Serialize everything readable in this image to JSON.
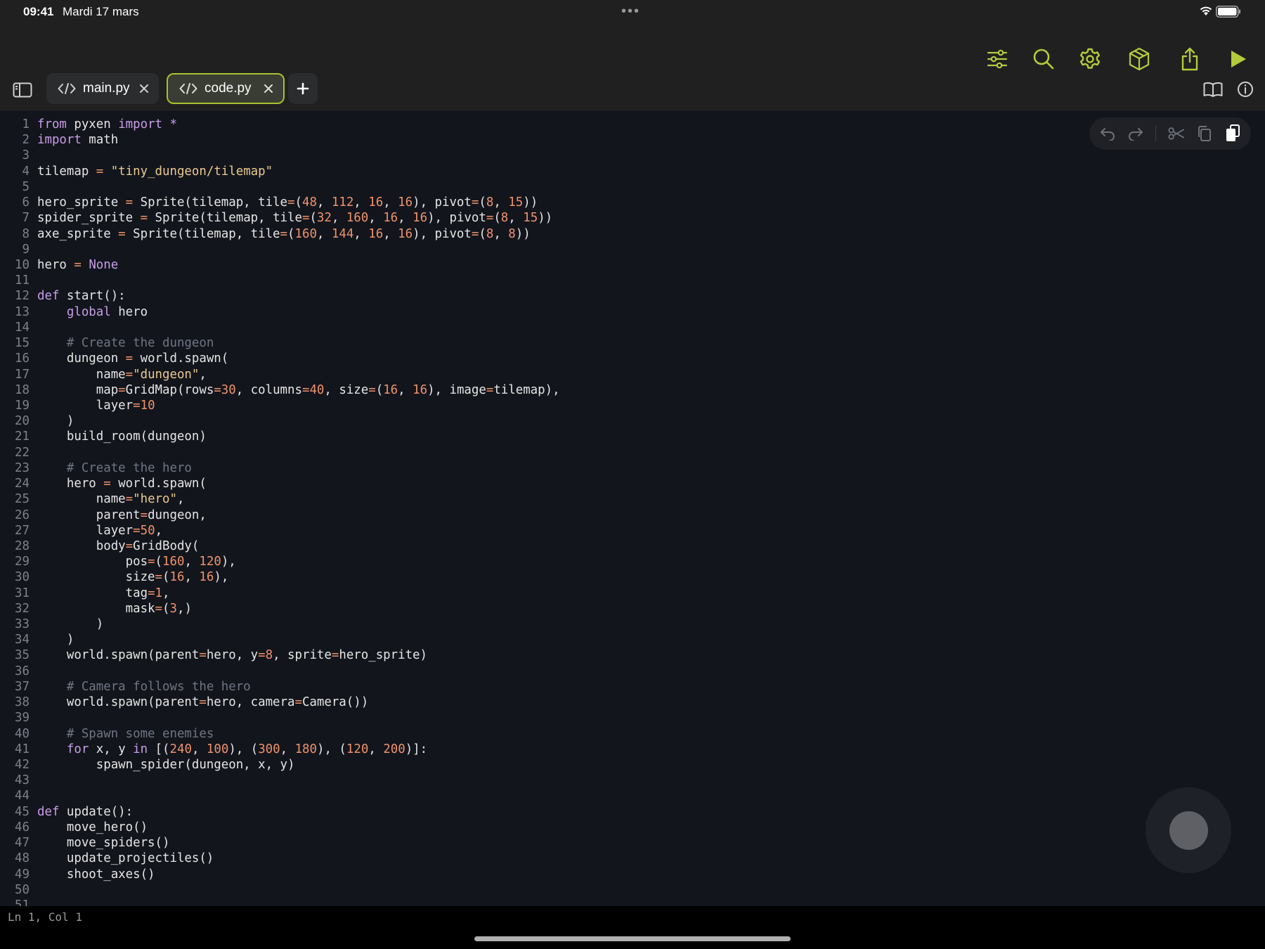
{
  "status": {
    "time": "09:41",
    "date": "Mardi 17 mars"
  },
  "toolbar": {
    "icons": [
      "sliders-icon",
      "search-icon",
      "gear-icon",
      "package-icon",
      "share-icon",
      "play-icon"
    ],
    "accent_color": "#b5cc3a"
  },
  "tabs": [
    {
      "label": "main.py",
      "active": false
    },
    {
      "label": "code.py",
      "active": true
    }
  ],
  "editor": {
    "lines": [
      "from pyxen import *",
      "import math",
      "",
      "tilemap = \"tiny_dungeon/tilemap\"",
      "",
      "hero_sprite = Sprite(tilemap, tile=(48, 112, 16, 16), pivot=(8, 15))",
      "spider_sprite = Sprite(tilemap, tile=(32, 160, 16, 16), pivot=(8, 15))",
      "axe_sprite = Sprite(tilemap, tile=(160, 144, 16, 16), pivot=(8, 8))",
      "",
      "hero = None",
      "",
      "def start():",
      "    global hero",
      "",
      "    # Create the dungeon",
      "    dungeon = world.spawn(",
      "        name=\"dungeon\",",
      "        map=GridMap(rows=30, columns=40, size=(16, 16), image=tilemap),",
      "        layer=10",
      "    )",
      "    build_room(dungeon)",
      "",
      "    # Create the hero",
      "    hero = world.spawn(",
      "        name=\"hero\",",
      "        parent=dungeon,",
      "        layer=50,",
      "        body=GridBody(",
      "            pos=(160, 120),",
      "            size=(16, 16),",
      "            tag=1,",
      "            mask=(3,)",
      "        )",
      "    )",
      "    world.spawn(parent=hero, y=8, sprite=hero_sprite)",
      "",
      "    # Camera follows the hero",
      "    world.spawn(parent=hero, camera=Camera())",
      "",
      "    # Spawn some enemies",
      "    for x, y in [(240, 100), (300, 180), (120, 200)]:",
      "        spawn_spider(dungeon, x, y)",
      "",
      "",
      "def update():",
      "    move_hero()",
      "    move_spiders()",
      "    update_projectiles()",
      "    shoot_axes()",
      "",
      ""
    ]
  },
  "edit_toolbar": {
    "icons": [
      "undo-icon",
      "redo-icon",
      "cut-icon",
      "copy-icon",
      "paste-icon"
    ]
  },
  "footer": {
    "cursor_position": "Ln 1, Col 1"
  }
}
